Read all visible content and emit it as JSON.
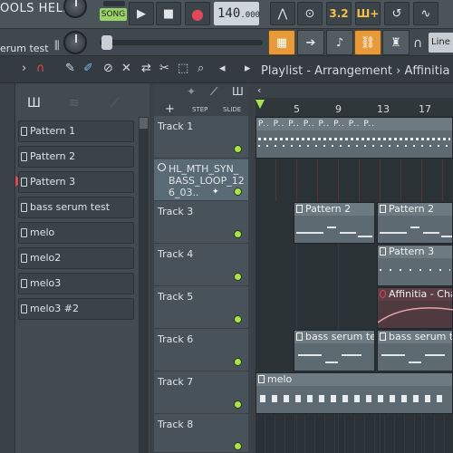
{
  "menu": {
    "tools_help": "OOLS HELP"
  },
  "toolbar": {
    "song_label": "SONG",
    "tempo_main": "140",
    "tempo_frac": ".000",
    "time_sig": "3.2"
  },
  "hint": {
    "text": "erum test"
  },
  "snap": {
    "value": "Line"
  },
  "playlist": {
    "title": "Playlist - Arrangement",
    "arrangement": "Affinitia - C"
  },
  "picker": {
    "items": [
      {
        "label": "Pattern 1"
      },
      {
        "label": "Pattern 2"
      },
      {
        "label": "Pattern 3"
      },
      {
        "label": "bass serum test"
      },
      {
        "label": "melo"
      },
      {
        "label": "melo2"
      },
      {
        "label": "melo3"
      },
      {
        "label": "melo3 #2"
      }
    ]
  },
  "tracks_header": {
    "step": "STEP",
    "slide": "SLIDE",
    "add": "+"
  },
  "tracks": [
    {
      "label": "Track 1"
    },
    {
      "label": "HL_MTH_SYN_BASS_LOOP_126_03.."
    },
    {
      "label": "Track 3"
    },
    {
      "label": "Track 4"
    },
    {
      "label": "Track 5"
    },
    {
      "label": "Track 6"
    },
    {
      "label": "Track 7"
    },
    {
      "label": "Track 8"
    }
  ],
  "ruler": {
    "bars": [
      "5",
      "9",
      "13",
      "17"
    ]
  },
  "clips": {
    "p1": "P..",
    "pattern2": "Pattern 2",
    "pattern3": "Pattern 3",
    "audio": "Affinitia - Cha",
    "bass": "bass serum test",
    "melo": "melo"
  },
  "colors": {
    "accent": "#e79a3a",
    "active_led": "#a9e24f",
    "song": "#9ad16a"
  }
}
